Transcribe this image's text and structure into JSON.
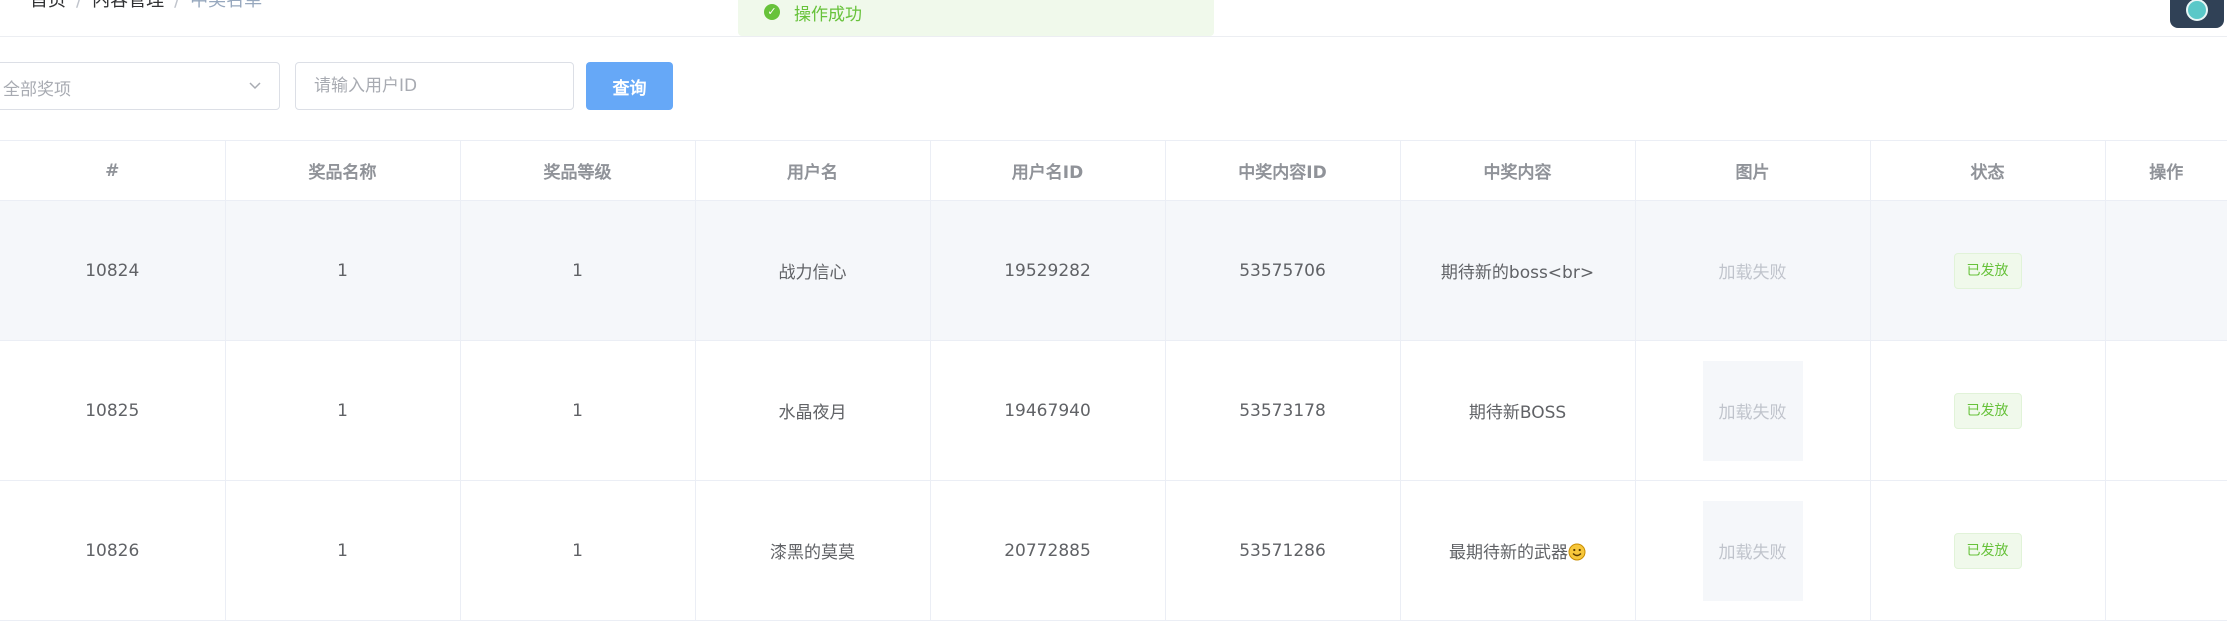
{
  "breadcrumb": [
    "首页",
    "内容管理",
    "中奖名单"
  ],
  "toast": {
    "message": "操作成功",
    "color": "#67c23a"
  },
  "filter": {
    "prize_placeholder": "全部奖项",
    "user_id_placeholder": "请输入用户ID",
    "query_label": "查询"
  },
  "table": {
    "columns": [
      "#",
      "奖品名称",
      "奖品等级",
      "用户名",
      "用户名ID",
      "中奖内容ID",
      "中奖内容",
      "图片",
      "状态",
      "操作"
    ],
    "rows": [
      {
        "id": "10824",
        "prize_name": "1",
        "prize_level": "1",
        "username": "战力信心",
        "user_id": "19529282",
        "content_id": "53575706",
        "content": "期待新的boss<br>",
        "image": "加载失败",
        "status": "已发放"
      },
      {
        "id": "10825",
        "prize_name": "1",
        "prize_level": "1",
        "username": "水晶夜月",
        "user_id": "19467940",
        "content_id": "53573178",
        "content": "期待新BOSS",
        "image": "加载失败",
        "status": "已发放"
      },
      {
        "id": "10826",
        "prize_name": "1",
        "prize_level": "1",
        "username": "漆黑的莫莫",
        "user_id": "20772885",
        "content_id": "53571286",
        "content": "最期待新的武器",
        "image": "加载失败",
        "status": "已发放"
      }
    ]
  },
  "colors": {
    "primary_button": "#66a8f7",
    "success": "#67c23a",
    "row_highlight": "#f5f7fa"
  }
}
